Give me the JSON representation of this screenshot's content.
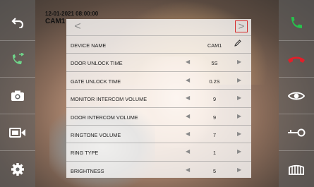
{
  "overlay": {
    "date_time": "12-01-2021  08:00:00",
    "camera": "CAM1"
  },
  "left_sidebar": [
    {
      "name": "back-icon",
      "color": "#ffffff"
    },
    {
      "name": "call-transfer-icon",
      "color": "#6fd58a"
    },
    {
      "name": "camera-icon",
      "color": "#ffffff"
    },
    {
      "name": "video-record-icon",
      "color": "#ffffff"
    },
    {
      "name": "gear-icon",
      "color": "#ffffff"
    }
  ],
  "right_sidebar": [
    {
      "name": "phone-answer-icon",
      "color": "#27c24c"
    },
    {
      "name": "phone-hangup-icon",
      "color": "#e0202a"
    },
    {
      "name": "eye-icon",
      "color": "#ffffff"
    },
    {
      "name": "unlock-key-icon",
      "color": "#ffffff"
    },
    {
      "name": "gate-icon",
      "color": "#ffffff"
    }
  ],
  "settings": {
    "nav_prev": "<",
    "nav_next": ">",
    "rows": [
      {
        "label": "DEVICE NAME",
        "value": "CAM1",
        "editable": true
      },
      {
        "label": "DOOR UNLOCK TIME",
        "value": "5S"
      },
      {
        "label": "GATE UNLOCK TIME",
        "value": "0.2S"
      },
      {
        "label": "MONITOR INTERCOM VOLUME",
        "value": "9"
      },
      {
        "label": "DOOR INTERCOM VOLUME",
        "value": "9"
      },
      {
        "label": "RINGTONE VOLUME",
        "value": "7"
      },
      {
        "label": "RING TYPE",
        "value": "1"
      },
      {
        "label": "BRIGHTNESS",
        "value": "5"
      }
    ],
    "dec_glyph": "◀",
    "inc_glyph": "▶"
  }
}
